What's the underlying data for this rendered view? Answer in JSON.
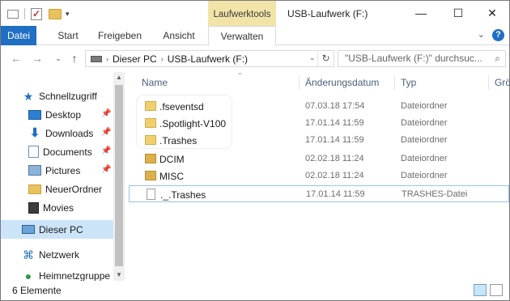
{
  "window": {
    "title": "USB-Laufwerk (F:)",
    "context_tab": "Laufwerktools",
    "controls": {
      "minimize": "—",
      "maximize": "☐",
      "close": "✕"
    }
  },
  "ribbon": {
    "tabs": [
      "Datei",
      "Start",
      "Freigeben",
      "Ansicht",
      "Verwalten"
    ],
    "active_tab": "Verwalten",
    "file_tab_color": "#1f6fc5",
    "context_tab_color": "#f2e4a7"
  },
  "address": {
    "crumbs": [
      "Dieser PC",
      "USB-Laufwerk (F:)"
    ],
    "search_placeholder": "\"USB-Laufwerk (F:)\" durchsuc..."
  },
  "nav": {
    "items": [
      {
        "label": "Schnellzugriff",
        "icon": "star-icon",
        "pinned": false
      },
      {
        "label": "Desktop",
        "icon": "desktop-icon",
        "pinned": true
      },
      {
        "label": "Downloads",
        "icon": "download-icon",
        "pinned": true
      },
      {
        "label": "Documents",
        "icon": "documents-icon",
        "pinned": true
      },
      {
        "label": "Pictures",
        "icon": "pictures-icon",
        "pinned": true
      },
      {
        "label": "NeuerOrdner",
        "icon": "folder-icon",
        "pinned": false
      },
      {
        "label": "Movies",
        "icon": "movies-icon",
        "pinned": false
      },
      {
        "label": "Dieser PC",
        "icon": "pc-icon",
        "pinned": false,
        "selected": true
      },
      {
        "label": "Netzwerk",
        "icon": "network-icon",
        "pinned": false
      },
      {
        "label": "Heimnetzgruppe",
        "icon": "homegroup-icon",
        "pinned": false
      }
    ]
  },
  "columns": {
    "name": "Name",
    "date": "Änderungsdatum",
    "type": "Typ",
    "size": "Grö"
  },
  "files": [
    {
      "name": ".fseventsd",
      "date": "07.03.18 17:54",
      "type": "Dateiordner",
      "kind": "folder"
    },
    {
      "name": ".Spotlight-V100",
      "date": "17.01.14 11:59",
      "type": "Dateiordner",
      "kind": "folder"
    },
    {
      "name": ".Trashes",
      "date": "17.01.14 11:59",
      "type": "Dateiordner",
      "kind": "folder"
    },
    {
      "name": "DCIM",
      "date": "02.02.18 11:24",
      "type": "Dateiordner",
      "kind": "folder"
    },
    {
      "name": "MISC",
      "date": "02.02.18 11:24",
      "type": "Dateiordner",
      "kind": "folder"
    },
    {
      "name": "._.Trashes",
      "date": "17.01.14 11:59",
      "type": "TRASHES-Datei",
      "kind": "file"
    }
  ],
  "status": {
    "count": "6 Elemente"
  }
}
